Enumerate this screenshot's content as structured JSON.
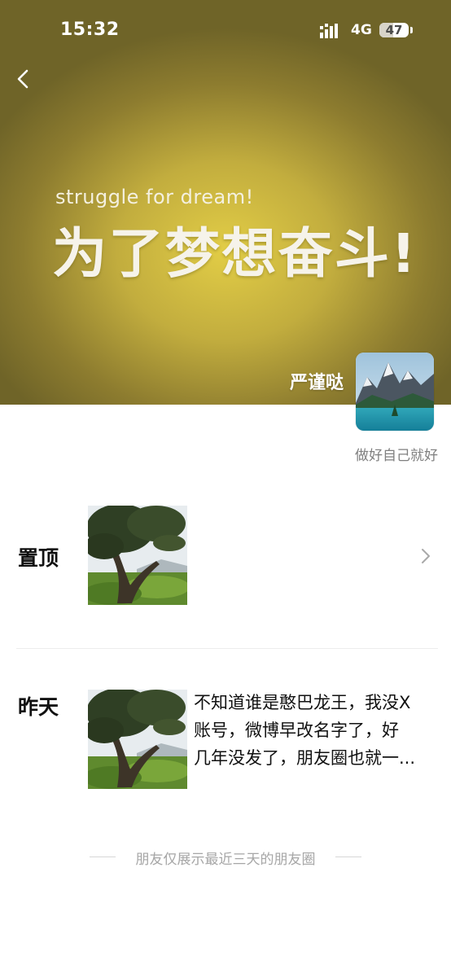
{
  "status_bar": {
    "time": "15:32",
    "network": "4G",
    "battery": "47",
    "battery_level": 0.47
  },
  "cover": {
    "slogan_en": "struggle for dream!",
    "slogan_zh": "为了梦想奋斗!"
  },
  "profile": {
    "username": "严谨哒",
    "signature": "做好自己就好",
    "avatar_icon": "mountain-lake-avatar"
  },
  "sections": [
    {
      "label": "置顶",
      "thumb_icon": "tree-photo"
    },
    {
      "label": "昨天",
      "thumb_icon": "tree-photo",
      "text_lines": [
        "不知道谁是憨巴龙王，我没X",
        "账号，微博早改名字了，好",
        "几年没发了，朋友圈也就一..."
      ]
    }
  ],
  "footer": {
    "text": "朋友仅展示最近三天的朋友圈"
  },
  "colors": {
    "cover_center": "#e2cd46",
    "cover_edge": "#6f6428",
    "text_primary": "#111111",
    "text_secondary": "#7f7f7f"
  }
}
